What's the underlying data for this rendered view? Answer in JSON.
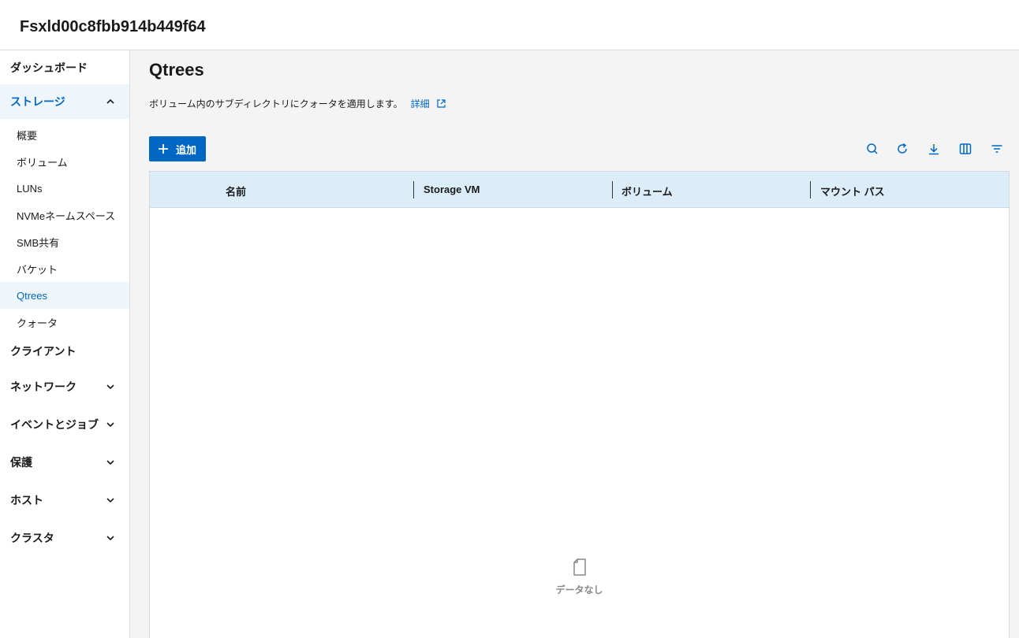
{
  "header": {
    "title": "Fsxld00c8fbb914b449f64"
  },
  "sidebar": {
    "sections": [
      {
        "label": "ダッシュボード"
      },
      {
        "label": "ストレージ"
      },
      {
        "label": "クライアント"
      },
      {
        "label": "ネットワーク"
      },
      {
        "label": "イベントとジョブ"
      },
      {
        "label": "保護"
      },
      {
        "label": "ホスト"
      },
      {
        "label": "クラスタ"
      }
    ],
    "storage_items": [
      {
        "label": "概要"
      },
      {
        "label": "ボリューム"
      },
      {
        "label": "LUNs"
      },
      {
        "label": "NVMeネームスペース"
      },
      {
        "label": "SMB共有"
      },
      {
        "label": "バケット"
      },
      {
        "label": "Qtrees"
      },
      {
        "label": "クォータ"
      }
    ]
  },
  "main": {
    "title": "Qtrees",
    "description": "ボリューム内のサブディレクトリにクォータを適用します。",
    "details_link": "詳細",
    "add_button": "追加",
    "columns": [
      "名前",
      "Storage VM",
      "ボリューム",
      "マウント パス"
    ],
    "empty_text": "データなし"
  },
  "colors": {
    "accent": "#0067c5",
    "header_bg": "#dcedfa"
  }
}
